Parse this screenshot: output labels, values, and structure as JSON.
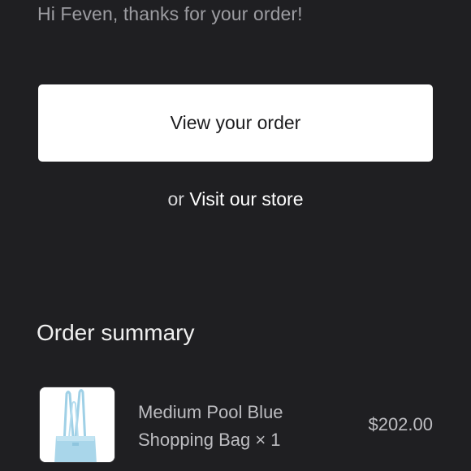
{
  "greeting": "Hi Feven, thanks for your order!",
  "view_order_button": "View your order",
  "store_link": {
    "prefix": "or",
    "label": "Visit our store"
  },
  "order_summary": {
    "title": "Order summary",
    "items": [
      {
        "name": "Medium Pool Blue Shopping Bag × 1",
        "price": "$202.00",
        "thumbnail_icon": "shopping-bag-image"
      }
    ]
  },
  "colors": {
    "background": "#1f1f22",
    "button_bg": "#ffffff",
    "muted_text": "#9d9da2",
    "product_blue": "#a9d6ea"
  }
}
